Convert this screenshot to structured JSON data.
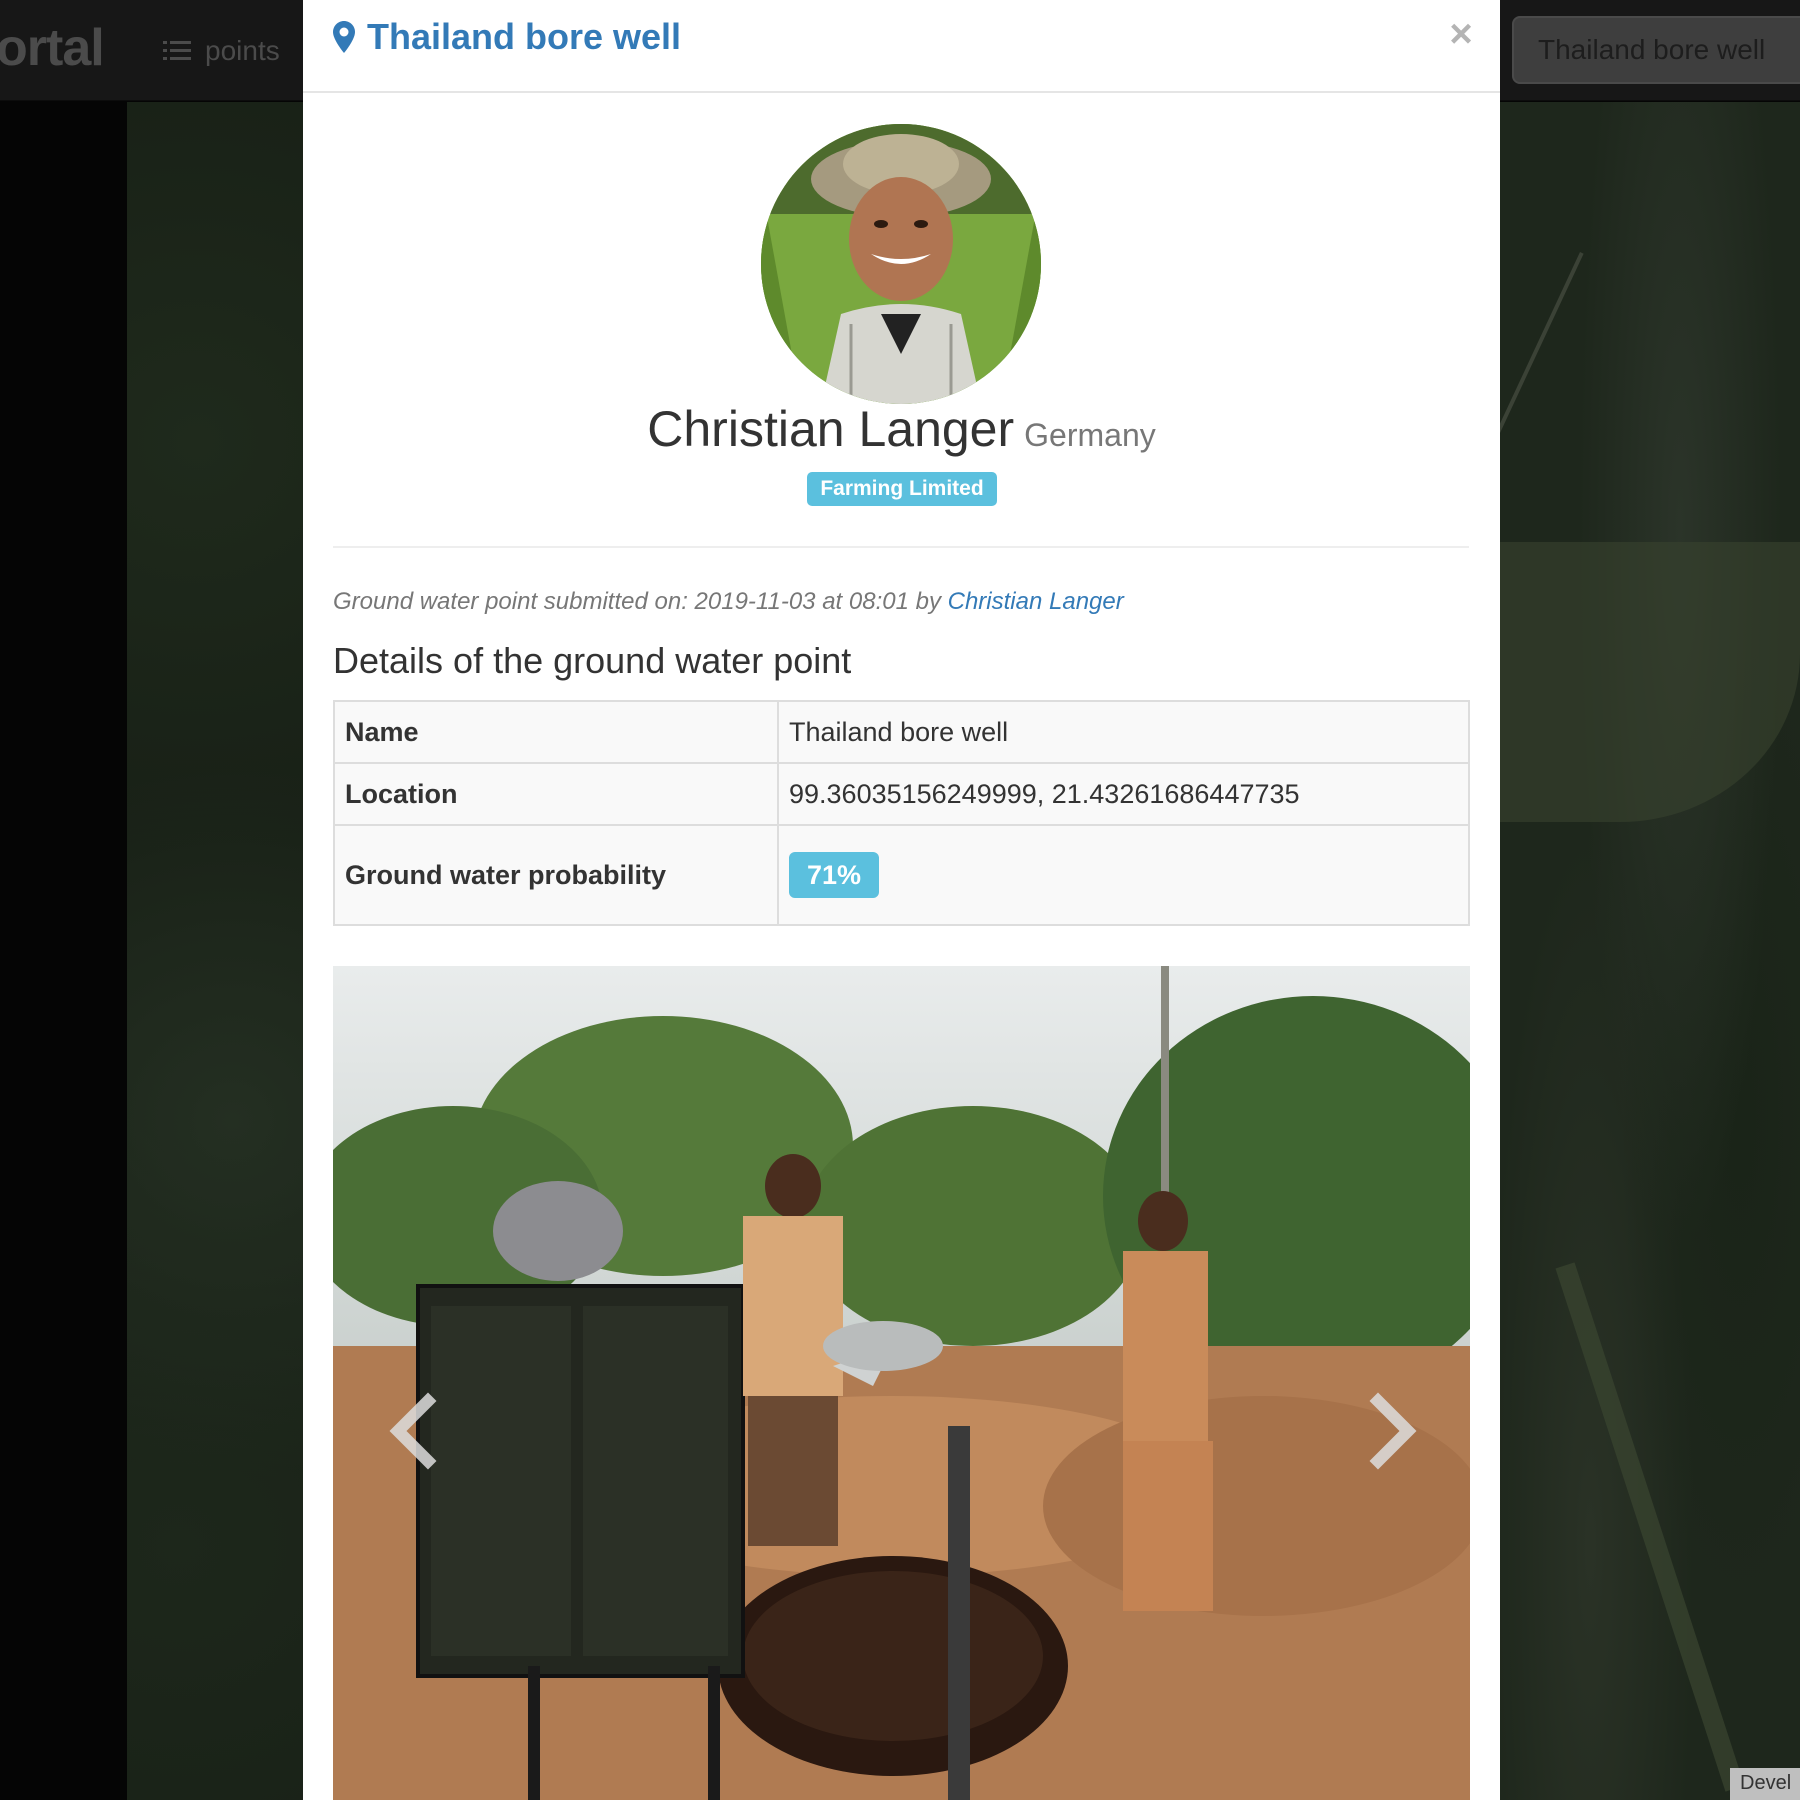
{
  "navbar": {
    "brand": "ortal",
    "points_label": "points",
    "search_value": "Thailand bore well",
    "list_icon": "list-icon"
  },
  "modal": {
    "title": "Thailand bore well",
    "title_icon": "map-marker-icon",
    "close_label": "×"
  },
  "profile": {
    "name": "Christian Langer",
    "country": "Germany",
    "organization": "Farming Limited"
  },
  "submission": {
    "prefix": "Ground water point submitted on: 2019-11-03 at 08:01 by",
    "author": "Christian Langer"
  },
  "details": {
    "heading": "Details of the ground water point",
    "rows": [
      {
        "label": "Name",
        "value": "Thailand bore well"
      },
      {
        "label": "Location",
        "value": "99.36035156249999, 21.43261686447735"
      },
      {
        "label": "Ground water probability",
        "value": "71%"
      }
    ]
  },
  "carousel": {
    "prev_icon": "chevron-left-icon",
    "next_icon": "chevron-right-icon"
  },
  "footer_tag": "Devel",
  "colors": {
    "link": "#337ab7",
    "badge": "#5bc0de",
    "text": "#333333",
    "muted": "#777777"
  }
}
